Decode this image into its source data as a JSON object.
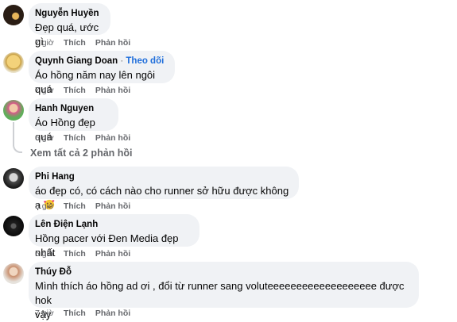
{
  "comments": [
    {
      "author": "Nguyễn Huyền",
      "text": "Đẹp quá, ước gì",
      "time": "7 giờ",
      "like": "Thích",
      "reply": "Phản hồi"
    },
    {
      "author": "Quynh Giang Doan",
      "follow": "Theo dõi",
      "text": "Áo hồng năm nay lên ngôi quá",
      "time": "7 giờ",
      "like": "Thích",
      "reply": "Phản hồi"
    },
    {
      "author": "Hanh Nguyen",
      "text": "Áo Hồng đẹp quá",
      "time": "6 giờ",
      "like": "Thích",
      "reply": "Phản hồi"
    },
    {
      "author": "Phi Hang",
      "text": "áo đẹp có, có cách nào cho runner sở hữu được không ạ",
      "time": "3 giờ",
      "like": "Thích",
      "reply": "Phản hồi"
    },
    {
      "author": "Lên Điện Lạnh",
      "text": "Hồng pacer với Đen Media đẹp nhất",
      "time": "6 giờ",
      "like": "Thích",
      "reply": "Phản hồi"
    },
    {
      "author": "Thúy Đỗ",
      "text_line1": "Mình thích áo hồng ad ơi , đổi từ runner sang voluteeeeeeeeeeeeeeeeeee được hok",
      "text_line2": "vậy",
      "time": "7 giờ",
      "like": "Thích",
      "reply": "Phản hồi"
    }
  ],
  "view_replies": "Xem tất cả 2 phản hồi",
  "colors": {
    "bubble": "#f0f2f5",
    "link": "#216fdb",
    "meta": "#65676b"
  }
}
